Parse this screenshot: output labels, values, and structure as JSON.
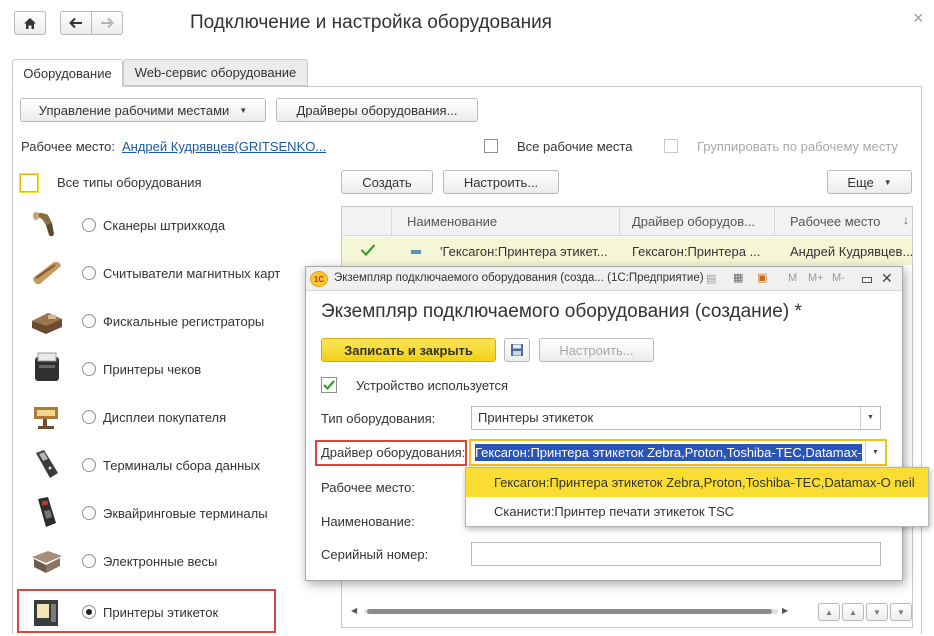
{
  "nav": {
    "home_icon": "home-icon",
    "back_icon": "arrow-left-icon",
    "forward_icon": "arrow-right-icon"
  },
  "window": {
    "title": "Подключение и настройка оборудования",
    "close_glyph": "×"
  },
  "tabs": [
    {
      "label": "Оборудование",
      "active": true
    },
    {
      "label": "Web-сервис оборудование",
      "active": false
    }
  ],
  "toolbar": {
    "workplaces_label": "Управление рабочими местами",
    "drivers_label": "Драйверы оборудования..."
  },
  "workplace": {
    "label": "Рабочее место:",
    "value": "Андрей Кудрявцев(GRITSENKO...",
    "all_places_label": "Все рабочие места",
    "group_label": "Группировать по рабочему месту"
  },
  "types": {
    "all_label": "Все типы оборудования",
    "items": [
      {
        "label": "Сканеры штрихкода",
        "icon": "barcode-scanner-icon",
        "selected": false
      },
      {
        "label": "Считыватели магнитных карт",
        "icon": "card-reader-icon",
        "selected": false
      },
      {
        "label": "Фискальные регистраторы",
        "icon": "fiscal-register-icon",
        "selected": false
      },
      {
        "label": "Принтеры чеков",
        "icon": "receipt-printer-icon",
        "selected": false
      },
      {
        "label": "Дисплеи покупателя",
        "icon": "customer-display-icon",
        "selected": false
      },
      {
        "label": "Терминалы сбора данных",
        "icon": "data-terminal-icon",
        "selected": false
      },
      {
        "label": "Эквайринговые терминалы",
        "icon": "acquiring-terminal-icon",
        "selected": false
      },
      {
        "label": "Электронные весы",
        "icon": "scales-icon",
        "selected": false
      },
      {
        "label": "Принтеры этикеток",
        "icon": "label-printer-icon",
        "selected": true
      }
    ]
  },
  "list_toolbar": {
    "create_label": "Создать",
    "configure_label": "Настроить...",
    "more_label": "Еще"
  },
  "table": {
    "columns": [
      "Наименование",
      "Драйвер оборудов...",
      "Рабочее место"
    ],
    "rows": [
      {
        "name": "'Гексагон:Принтера этикет...",
        "driver": "Гексагон:Принтера ...",
        "place": "Андрей Кудрявцев..."
      }
    ]
  },
  "dialog": {
    "title_bar": "Экземпляр подключаемого оборудования (созда... (1С:Предприятие)",
    "heading": "Экземпляр подключаемого оборудования (создание) *",
    "save_close_label": "Записать и закрыть",
    "configure_label": "Настроить...",
    "used_label": "Устройство используется",
    "type_label": "Тип оборудования:",
    "type_value": "Принтеры этикеток",
    "driver_label": "Драйвер оборудования:",
    "driver_value": "Гексагон:Принтера этикеток Zebra,Proton,Toshiba-TEC,Datamax-",
    "place_label": "Рабочее место:",
    "name_label": "Наименование:",
    "serial_label": "Серийный номер:",
    "titlebar_tools": [
      "M",
      "M+",
      "M-"
    ],
    "dropdown_options": [
      "Гексагон:Принтера этикеток Zebra,Proton,Toshiba-TEC,Datamax-O neil",
      "Сканисти:Принтер печати этикеток TSC"
    ]
  },
  "colors": {
    "accent_yellow": "#f9dd33",
    "highlight_red": "#d9463b",
    "selection_blue": "#2a55b8",
    "row_highlight": "#f4f6d6",
    "link_blue": "#1a5aa3"
  }
}
